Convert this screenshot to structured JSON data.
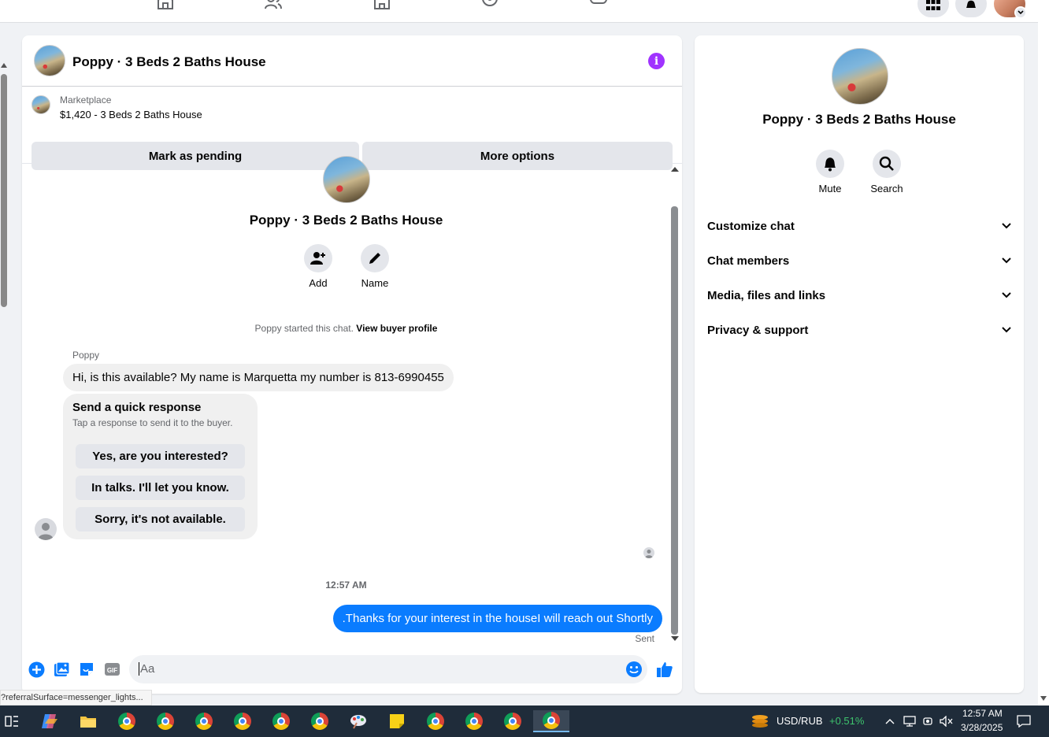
{
  "listing": {
    "title": "Poppy · 3 Beds 2 Baths House",
    "source": "Marketplace",
    "price_line": "$1,420 - 3 Beds 2 Baths House",
    "mark_pending": "Mark as pending",
    "more_options": "More options"
  },
  "chat_intro": {
    "name": "Poppy · 3 Beds 2 Baths House",
    "add_label": "Add",
    "name_label": "Name",
    "started_text": "Poppy started this chat.",
    "view_profile": "View buyer profile"
  },
  "messages": {
    "sender": "Poppy",
    "incoming": "Hi, is this available?  My name is Marquetta my number is 813-6990455",
    "quick_title": "Send a quick response",
    "quick_subtitle": "Tap a response to send it to the buyer.",
    "quick_replies": [
      "Yes, are you interested?",
      "In talks. I'll let you know.",
      "Sorry, it's not available."
    ],
    "timestamp": "12:57 AM",
    "outgoing": ".Thanks for your interest in the houseI will reach out Shortly",
    "status": "Sent"
  },
  "composer": {
    "placeholder": "Aa"
  },
  "info_panel": {
    "name": "Poppy · 3 Beds 2 Baths House",
    "mute_label": "Mute",
    "search_label": "Search",
    "sections": [
      "Customize chat",
      "Chat members",
      "Media, files and links",
      "Privacy & support"
    ]
  },
  "status_url": "?referralSurface=messenger_lights...",
  "taskbar": {
    "currency": "USD/RUB",
    "change": "+0.51%",
    "time": "12:57 AM",
    "date": "3/28/2025"
  },
  "colors": {
    "accent": "#0a7cff",
    "info": "#a033ff",
    "positive": "#3ec46d"
  }
}
